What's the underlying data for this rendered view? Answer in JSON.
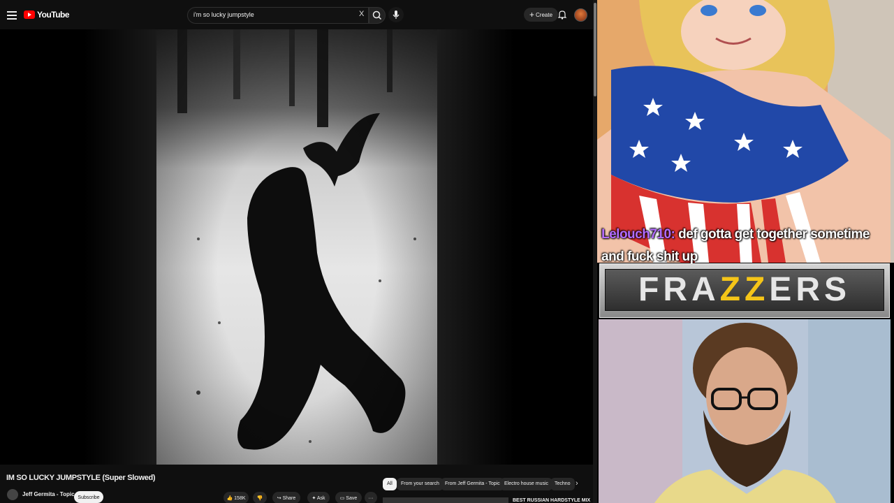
{
  "topbar": {
    "logo_text": "YouTube",
    "search_value": "i'm so lucky jumpstyle",
    "clear_label": "X",
    "create_label": "Create"
  },
  "video": {
    "title": "IM SO LUCKY JUMPSTYLE (Super Slowed)",
    "channel": "Jeff Germita - Topic",
    "subscribe_label": "Subscribe",
    "likes": "158K",
    "share_label": "Share",
    "ask_label": "Ask",
    "save_label": "Save",
    "more_label": "···"
  },
  "chips": [
    "All",
    "From your search",
    "From Jeff Germita - Topic",
    "Electro house music",
    "Techno"
  ],
  "recommendation": {
    "title": "BEST RUSSIAN HARDSTYLE MIX"
  },
  "overlay": {
    "chat_user": "Lelouch710:",
    "chat_message": "def gotta get together sometime and fuck shit up",
    "logo_part1": "FRA",
    "logo_part2": "ZZ",
    "logo_part3": "ERS"
  },
  "colors": {
    "brand_red": "#ff0000",
    "chat_name": "#b36bff",
    "logo_accent": "#f5c518"
  }
}
